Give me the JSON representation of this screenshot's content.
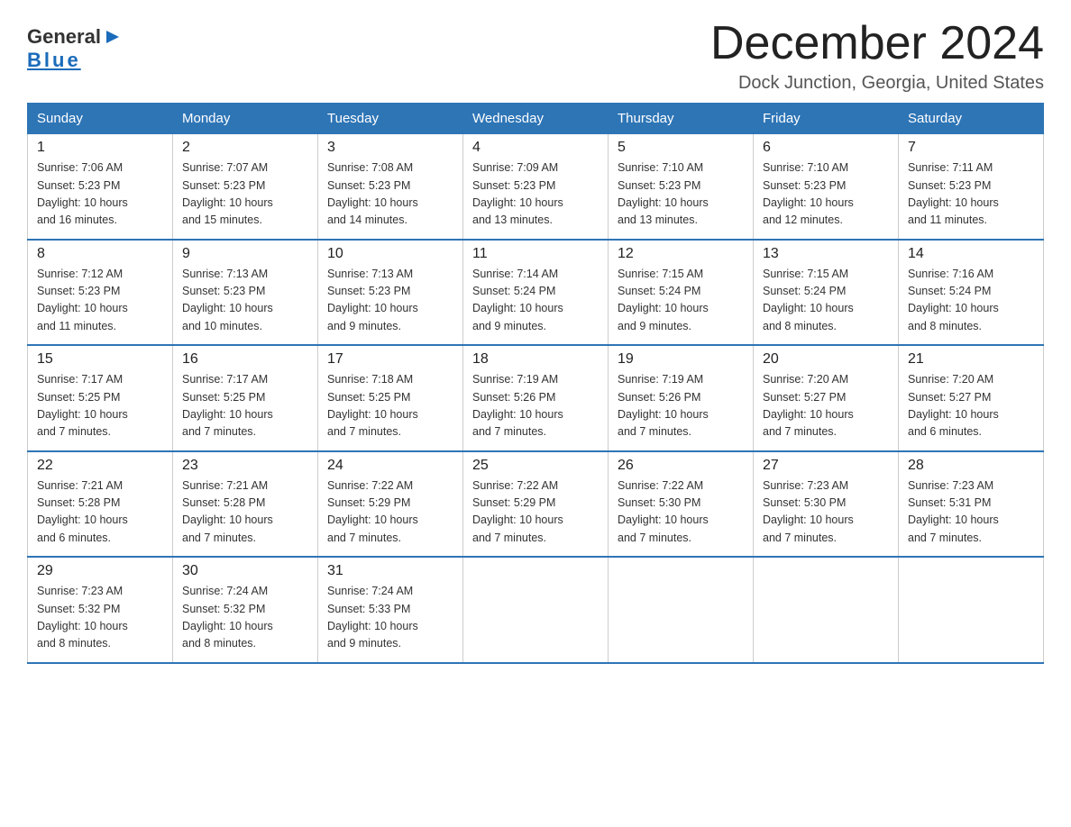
{
  "header": {
    "logo_general": "General",
    "logo_blue": "Blue",
    "month_title": "December 2024",
    "location": "Dock Junction, Georgia, United States"
  },
  "days_of_week": [
    "Sunday",
    "Monday",
    "Tuesday",
    "Wednesday",
    "Thursday",
    "Friday",
    "Saturday"
  ],
  "weeks": [
    [
      {
        "day": "1",
        "info": "Sunrise: 7:06 AM\nSunset: 5:23 PM\nDaylight: 10 hours\nand 16 minutes."
      },
      {
        "day": "2",
        "info": "Sunrise: 7:07 AM\nSunset: 5:23 PM\nDaylight: 10 hours\nand 15 minutes."
      },
      {
        "day": "3",
        "info": "Sunrise: 7:08 AM\nSunset: 5:23 PM\nDaylight: 10 hours\nand 14 minutes."
      },
      {
        "day": "4",
        "info": "Sunrise: 7:09 AM\nSunset: 5:23 PM\nDaylight: 10 hours\nand 13 minutes."
      },
      {
        "day": "5",
        "info": "Sunrise: 7:10 AM\nSunset: 5:23 PM\nDaylight: 10 hours\nand 13 minutes."
      },
      {
        "day": "6",
        "info": "Sunrise: 7:10 AM\nSunset: 5:23 PM\nDaylight: 10 hours\nand 12 minutes."
      },
      {
        "day": "7",
        "info": "Sunrise: 7:11 AM\nSunset: 5:23 PM\nDaylight: 10 hours\nand 11 minutes."
      }
    ],
    [
      {
        "day": "8",
        "info": "Sunrise: 7:12 AM\nSunset: 5:23 PM\nDaylight: 10 hours\nand 11 minutes."
      },
      {
        "day": "9",
        "info": "Sunrise: 7:13 AM\nSunset: 5:23 PM\nDaylight: 10 hours\nand 10 minutes."
      },
      {
        "day": "10",
        "info": "Sunrise: 7:13 AM\nSunset: 5:23 PM\nDaylight: 10 hours\nand 9 minutes."
      },
      {
        "day": "11",
        "info": "Sunrise: 7:14 AM\nSunset: 5:24 PM\nDaylight: 10 hours\nand 9 minutes."
      },
      {
        "day": "12",
        "info": "Sunrise: 7:15 AM\nSunset: 5:24 PM\nDaylight: 10 hours\nand 9 minutes."
      },
      {
        "day": "13",
        "info": "Sunrise: 7:15 AM\nSunset: 5:24 PM\nDaylight: 10 hours\nand 8 minutes."
      },
      {
        "day": "14",
        "info": "Sunrise: 7:16 AM\nSunset: 5:24 PM\nDaylight: 10 hours\nand 8 minutes."
      }
    ],
    [
      {
        "day": "15",
        "info": "Sunrise: 7:17 AM\nSunset: 5:25 PM\nDaylight: 10 hours\nand 7 minutes."
      },
      {
        "day": "16",
        "info": "Sunrise: 7:17 AM\nSunset: 5:25 PM\nDaylight: 10 hours\nand 7 minutes."
      },
      {
        "day": "17",
        "info": "Sunrise: 7:18 AM\nSunset: 5:25 PM\nDaylight: 10 hours\nand 7 minutes."
      },
      {
        "day": "18",
        "info": "Sunrise: 7:19 AM\nSunset: 5:26 PM\nDaylight: 10 hours\nand 7 minutes."
      },
      {
        "day": "19",
        "info": "Sunrise: 7:19 AM\nSunset: 5:26 PM\nDaylight: 10 hours\nand 7 minutes."
      },
      {
        "day": "20",
        "info": "Sunrise: 7:20 AM\nSunset: 5:27 PM\nDaylight: 10 hours\nand 7 minutes."
      },
      {
        "day": "21",
        "info": "Sunrise: 7:20 AM\nSunset: 5:27 PM\nDaylight: 10 hours\nand 6 minutes."
      }
    ],
    [
      {
        "day": "22",
        "info": "Sunrise: 7:21 AM\nSunset: 5:28 PM\nDaylight: 10 hours\nand 6 minutes."
      },
      {
        "day": "23",
        "info": "Sunrise: 7:21 AM\nSunset: 5:28 PM\nDaylight: 10 hours\nand 7 minutes."
      },
      {
        "day": "24",
        "info": "Sunrise: 7:22 AM\nSunset: 5:29 PM\nDaylight: 10 hours\nand 7 minutes."
      },
      {
        "day": "25",
        "info": "Sunrise: 7:22 AM\nSunset: 5:29 PM\nDaylight: 10 hours\nand 7 minutes."
      },
      {
        "day": "26",
        "info": "Sunrise: 7:22 AM\nSunset: 5:30 PM\nDaylight: 10 hours\nand 7 minutes."
      },
      {
        "day": "27",
        "info": "Sunrise: 7:23 AM\nSunset: 5:30 PM\nDaylight: 10 hours\nand 7 minutes."
      },
      {
        "day": "28",
        "info": "Sunrise: 7:23 AM\nSunset: 5:31 PM\nDaylight: 10 hours\nand 7 minutes."
      }
    ],
    [
      {
        "day": "29",
        "info": "Sunrise: 7:23 AM\nSunset: 5:32 PM\nDaylight: 10 hours\nand 8 minutes."
      },
      {
        "day": "30",
        "info": "Sunrise: 7:24 AM\nSunset: 5:32 PM\nDaylight: 10 hours\nand 8 minutes."
      },
      {
        "day": "31",
        "info": "Sunrise: 7:24 AM\nSunset: 5:33 PM\nDaylight: 10 hours\nand 9 minutes."
      },
      {
        "day": "",
        "info": ""
      },
      {
        "day": "",
        "info": ""
      },
      {
        "day": "",
        "info": ""
      },
      {
        "day": "",
        "info": ""
      }
    ]
  ]
}
